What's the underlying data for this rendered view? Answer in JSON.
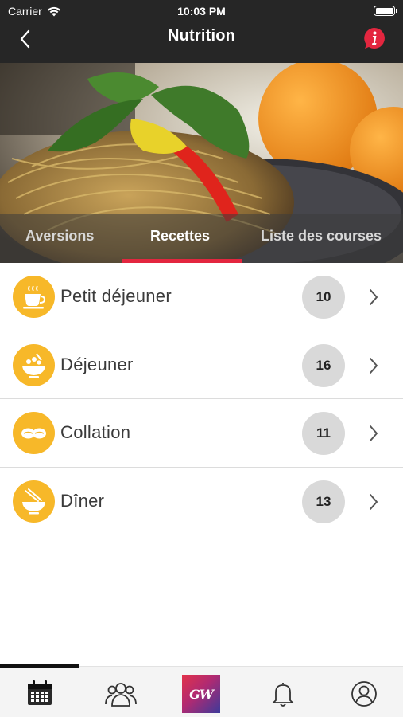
{
  "status_bar": {
    "carrier": "Carrier",
    "time": "10:03 PM"
  },
  "navbar": {
    "title": "Nutrition",
    "back_icon": "chevron-left-icon",
    "info_icon": "info-icon"
  },
  "tabs": [
    {
      "label": "Aversions",
      "active": false
    },
    {
      "label": "Recettes",
      "active": true
    },
    {
      "label": "Liste des courses",
      "active": false
    }
  ],
  "categories": [
    {
      "label": "Petit déjeuner",
      "count": "10",
      "icon": "coffee-cup-icon"
    },
    {
      "label": "Déjeuner",
      "count": "16",
      "icon": "salad-bowl-icon"
    },
    {
      "label": "Collation",
      "count": "11",
      "icon": "snack-icon"
    },
    {
      "label": "Dîner",
      "count": "13",
      "icon": "noodle-bowl-icon"
    }
  ],
  "tabbar": {
    "items": [
      "calendar-icon",
      "group-icon",
      "brand-logo",
      "bell-icon",
      "profile-icon"
    ],
    "brand_text": "GW",
    "active_index": 0
  },
  "colors": {
    "accent": "#e3263f",
    "icon_bg": "#f7b829",
    "count_bg": "#d9d9d9",
    "header_bg": "#262626"
  }
}
